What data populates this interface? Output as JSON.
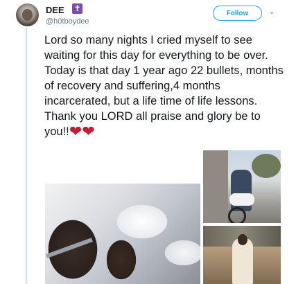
{
  "author": {
    "display_name": "DEE",
    "verified_symbol": "✝",
    "handle": "@h0tboydee"
  },
  "follow_button": {
    "label": "Follow"
  },
  "tweet": {
    "text": "Lord so many nights I cried myself to see waiting for this day for everything to be over. Today is that day 1 year ago 22 bullets, months of recovery and suffering,4 months incarcerated, but a life time of life lessons. Thank you LORD all praise and glory be to you!!",
    "emojis": [
      "heart-icon",
      "heart-icon"
    ],
    "emoji_glyph": "❤"
  },
  "colors": {
    "accent": "#1da1f2",
    "heart": "#c51c34",
    "verified": "#7a4fb0"
  }
}
